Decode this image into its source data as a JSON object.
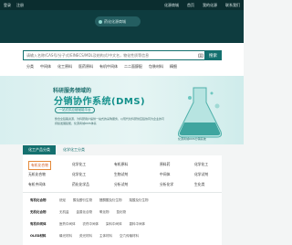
{
  "topbar": {
    "left": [
      "登录",
      "注册"
    ],
    "right": [
      "化源商城",
      "首页",
      "我的化源",
      "联系我们"
    ]
  },
  "logo": {
    "text": "药化化源商城"
  },
  "search": {
    "placeholder": "请输入名称/CAS号/分子式/EINECS/MDL及结构式/中文名，物化性质等信息",
    "button_label": "搜索"
  },
  "categories": [
    "分类",
    "中间体",
    "化工原料",
    "医药原料",
    "有机中间体",
    "二二面醇配",
    "包装材料",
    "精细"
  ],
  "banner": {
    "title": "科研服务领域的",
    "subtitle": "分销协作系统(DMS)",
    "pill": "一站式供应链赋能平台",
    "desc": "整合全链路资源，为科研用户提供一站式的采购服务，以现代化科研供应链协同为企业的可持续发展赋能，化源商城DMS体系",
    "contact": "化源商城DMS分销系统"
  },
  "tabs": [
    "化工产品分类",
    "化学化工分类"
  ],
  "catgrid": [
    [
      "有机化合物",
      "化学化工",
      "有机原料",
      "原料药",
      "化学化工"
    ],
    [
      "无机化合物",
      "化学化工",
      "生物试剂",
      "中间体",
      "化学试剂"
    ],
    [
      "有机中间体",
      "药化化学品",
      "分析试剂",
      "分析化学",
      "生化类"
    ]
  ],
  "subgrid": [
    {
      "h": "有机化合物",
      "v": [
        "烷烃",
        "醇及酚衍生物",
        "醛酮醌及衍生物",
        "羧酸及衍生物",
        "其他"
      ]
    },
    {
      "h": "无机化合物",
      "v": [
        "无机盐",
        "金属化合物",
        "氧化物",
        "氢化物"
      ]
    },
    {
      "h": "有机中间体",
      "v": [
        "医药中间体",
        "农药中间体",
        "染料中间体",
        "香料中间体"
      ]
    },
    {
      "h": "OLED材料",
      "v": [
        "磷光材料",
        "荧光材料",
        "主体材料",
        "空穴传输材料"
      ]
    }
  ]
}
